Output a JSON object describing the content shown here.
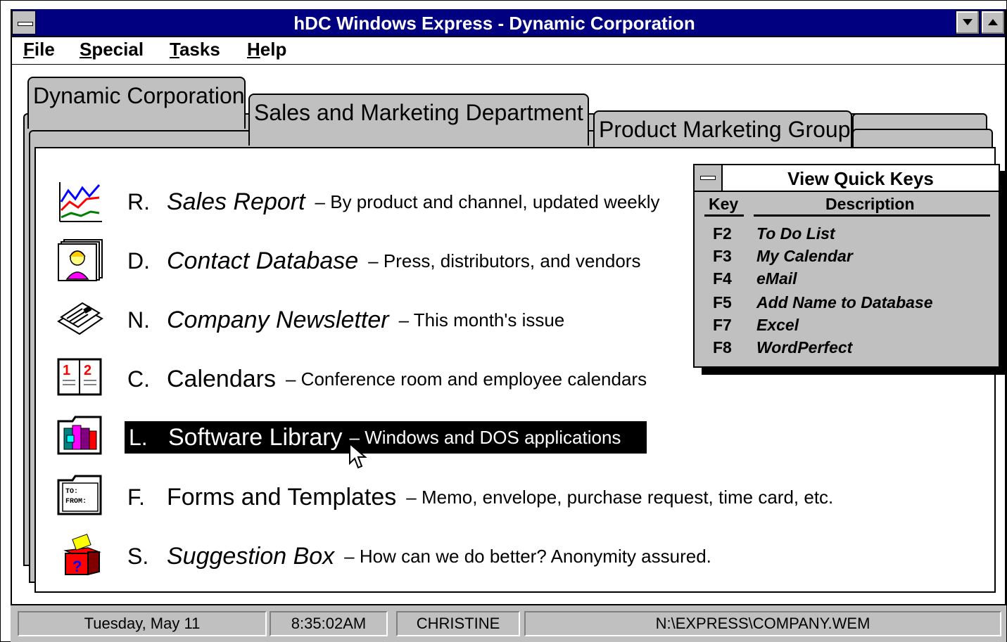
{
  "window": {
    "title": "hDC Windows Express - Dynamic Corporation"
  },
  "menu": [
    {
      "label": "File"
    },
    {
      "label": "Special"
    },
    {
      "label": "Tasks"
    },
    {
      "label": "Help"
    }
  ],
  "tabs": [
    {
      "label": "Dynamic Corporation"
    },
    {
      "label": "Sales and Marketing Department"
    },
    {
      "label": "Product Marketing Group"
    }
  ],
  "items": [
    {
      "key": "R.",
      "name": "Sales Report",
      "desc": "– By product and channel, updated weekly",
      "icon": "line-chart-icon",
      "italic": true
    },
    {
      "key": "D.",
      "name": "Contact Database",
      "desc": "– Press, distributors, and vendors",
      "icon": "rolodex-card-icon",
      "italic": true
    },
    {
      "key": "N.",
      "name": "Company Newsletter",
      "desc": "– This month's issue",
      "icon": "newspaper-icon",
      "italic": true
    },
    {
      "key": "C.",
      "name": "Calendars",
      "desc": "– Conference room and employee calendars",
      "icon": "calendar-icon",
      "italic": false
    },
    {
      "key": "L.",
      "name": "Software Library",
      "desc": "– Windows and DOS applications",
      "icon": "software-folder-icon",
      "italic": false,
      "selected": true
    },
    {
      "key": "F.",
      "name": "Forms and Templates",
      "desc": "– Memo, envelope, purchase request, time card, etc.",
      "icon": "memo-form-icon",
      "italic": false
    },
    {
      "key": "S.",
      "name": "Suggestion Box",
      "desc": "– How can we do better?  Anonymity assured.",
      "icon": "suggestion-box-icon",
      "italic": true
    }
  ],
  "quick_keys": {
    "title": "View Quick Keys",
    "col_key": "Key",
    "col_desc": "Description",
    "rows": [
      {
        "key": "F2",
        "desc": "To Do List"
      },
      {
        "key": "F3",
        "desc": "My Calendar"
      },
      {
        "key": "F4",
        "desc": "eMail"
      },
      {
        "key": "F5",
        "desc": "Add Name to Database"
      },
      {
        "key": "F7",
        "desc": "Excel"
      },
      {
        "key": "F8",
        "desc": "WordPerfect"
      }
    ]
  },
  "status": {
    "date": "Tuesday, May 11",
    "time": "8:35:02AM",
    "user": "CHRISTINE",
    "file": "N:\\EXPRESS\\COMPANY.WEM"
  },
  "colors": {
    "titlebar": "#000080",
    "panel": "#c0c0c0",
    "selection": "#000000"
  }
}
